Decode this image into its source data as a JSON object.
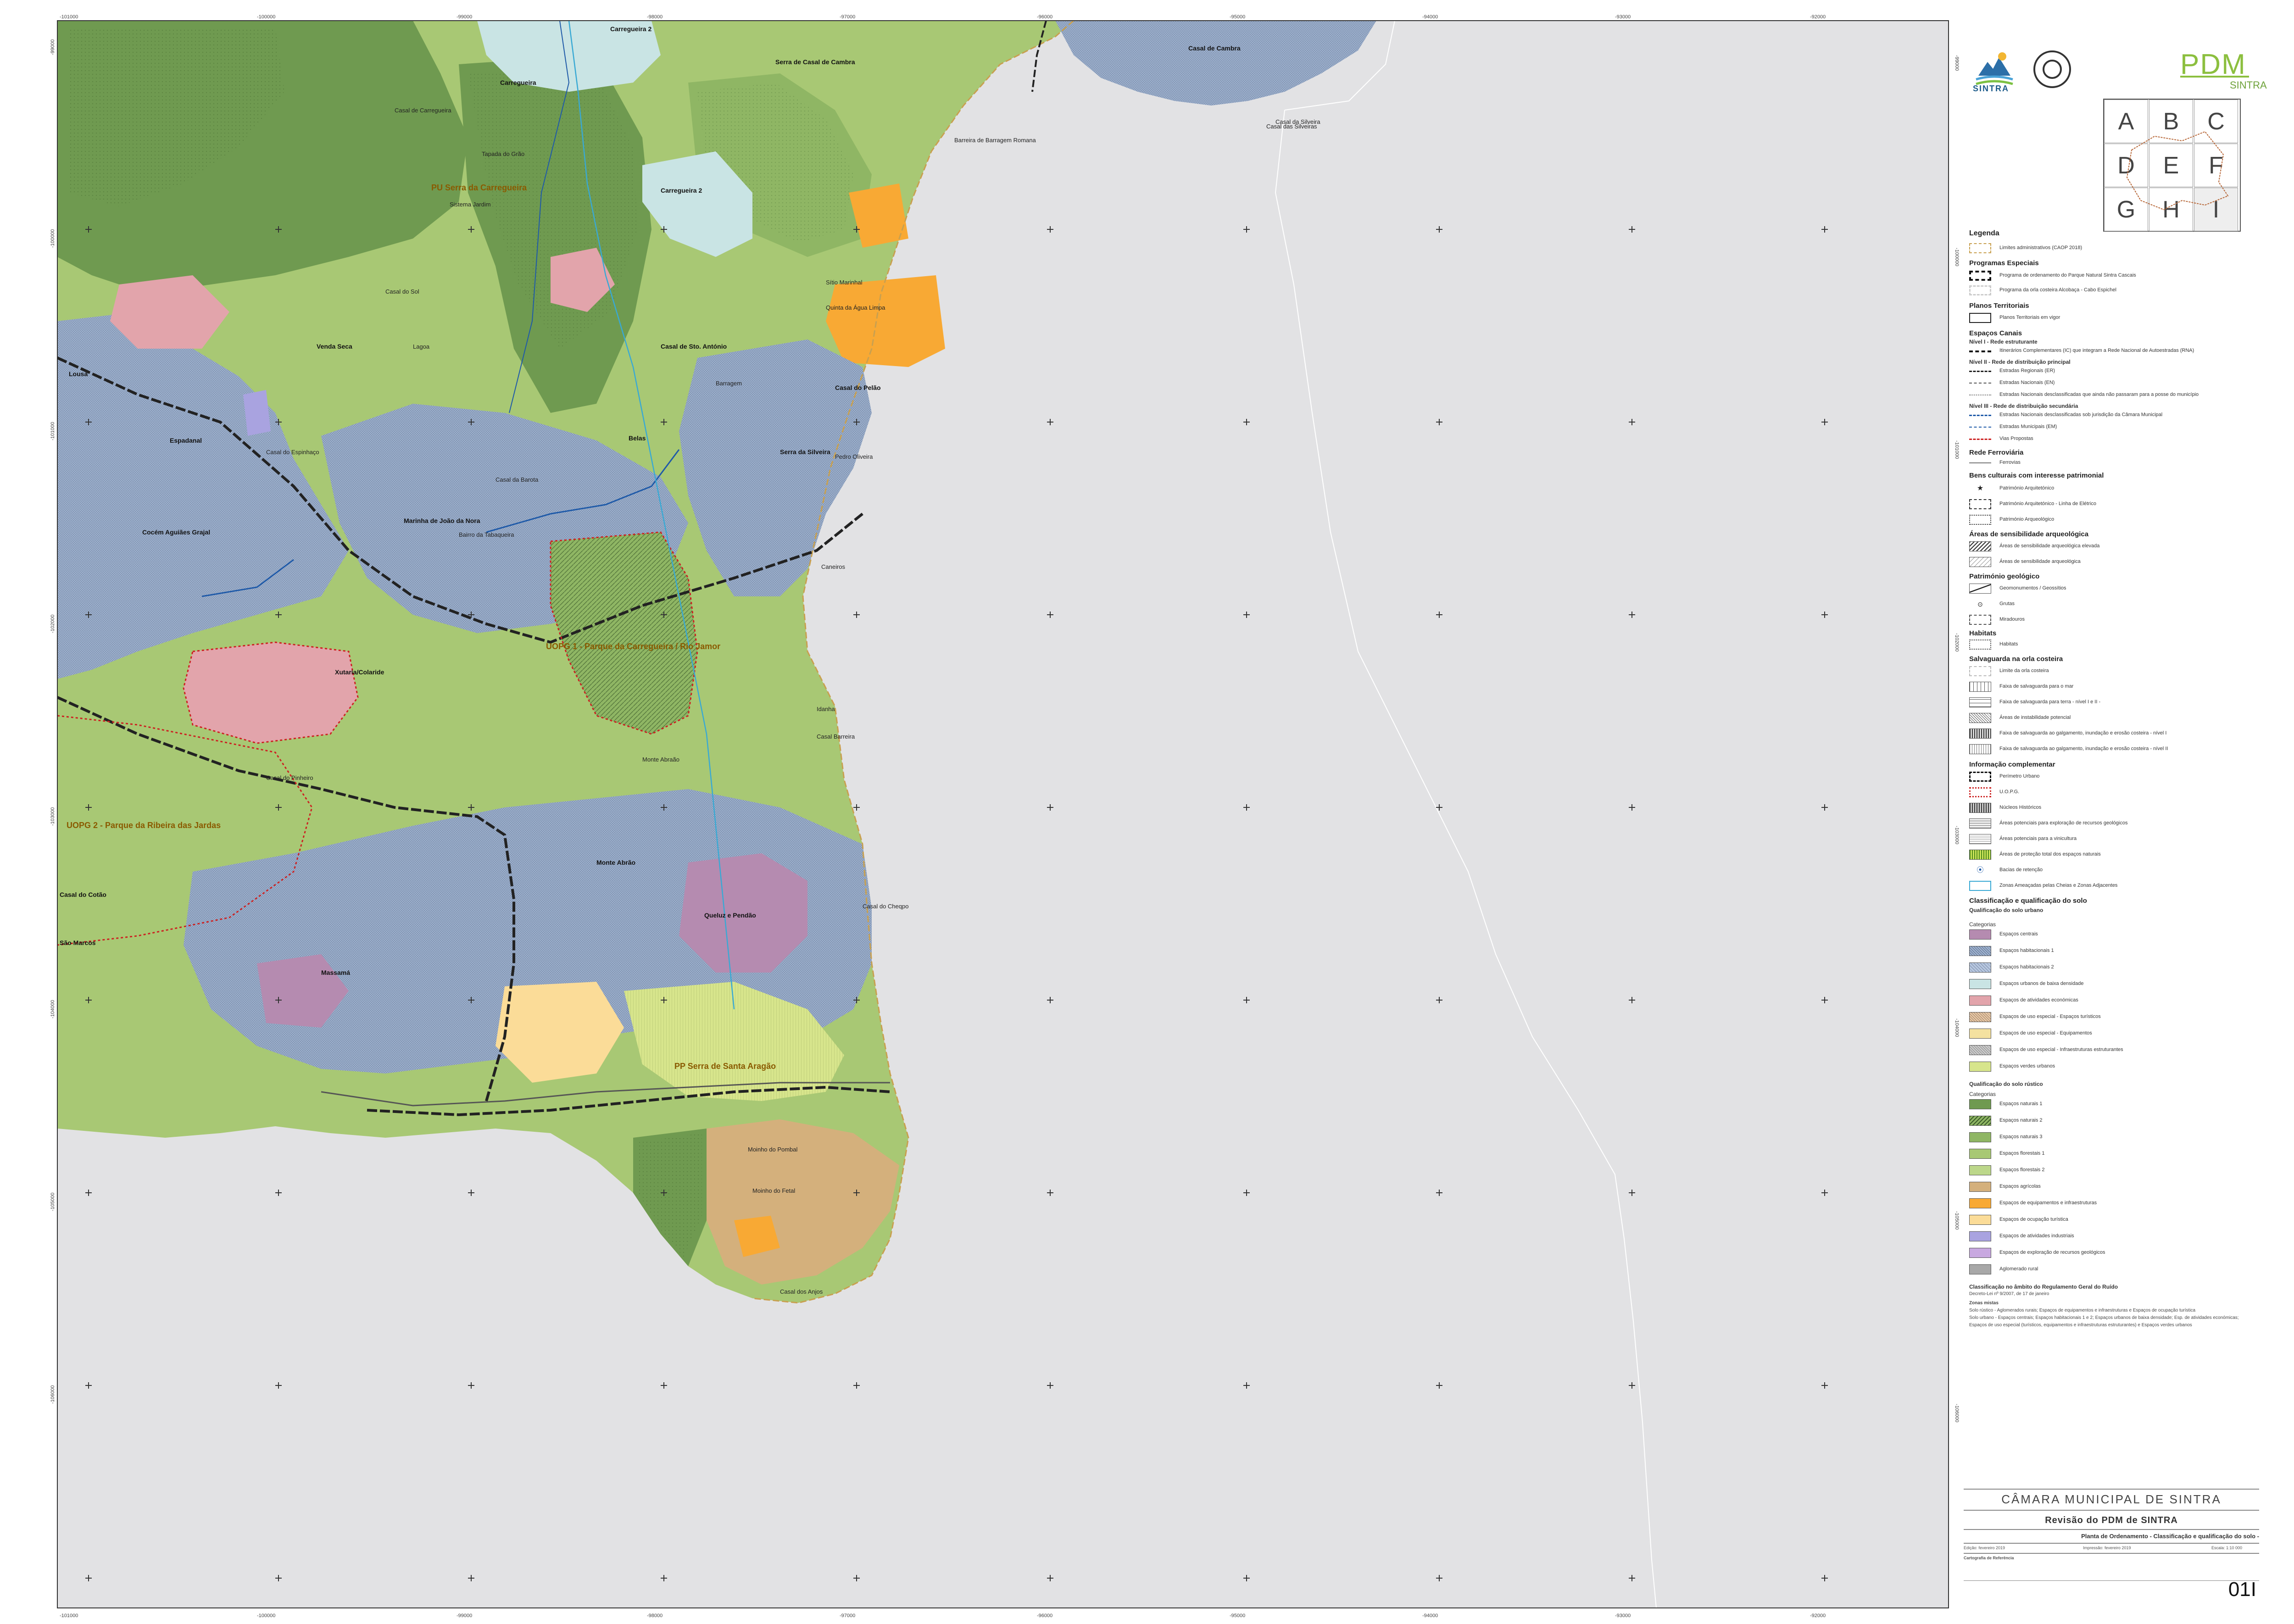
{
  "map": {
    "ticks_top": [
      "-101000",
      "-100000",
      "-99000",
      "-98000",
      "-97000",
      "-96000",
      "-95000",
      "-94000",
      "-93000",
      "-92000"
    ],
    "ticks_left": [
      "-99000",
      "-100000",
      "-101000",
      "-102000",
      "-103000",
      "-104000",
      "-105000",
      "-106000"
    ],
    "places_bold": [
      "Carregueira 2",
      "Serra de Casal de Cambra",
      "Casal de Cambra",
      "Carregueira",
      "Carregueira 2",
      "Venda Seca",
      "Casal de Sto. António",
      "Lousa",
      "Espadanal",
      "Serra da Silveira",
      "Belas",
      "Marinha de João da Nora",
      "Cocém Aguiães Grajal",
      "Xutaria/Colaride",
      "Monte Abrão",
      "Queluz e Pendão",
      "Massamá",
      "Casal do Cotão",
      "São Marcos",
      "Casal do Pelão"
    ],
    "places": [
      "Tapada do Grão",
      "Casal da Silveira",
      "Sistema Jardim",
      "Sítio Marinhal",
      "Quinta da Água Limpa",
      "Casal do Sol",
      "Lagoa",
      "Casal do Espinhaço",
      "Pedro Oliveira",
      "Caneiros",
      "Barragem",
      "Casal da Barota",
      "Idanha",
      "Bairro da Tabaqueira",
      "Casal de Carregueira",
      "Casal Barreira",
      "Monte Abraão",
      "Casal do Cheqpo",
      "Moinho do Pombal",
      "Moinho do Fetal",
      "Casal dos Anjos",
      "Casal das Silveiras",
      "Barreira de Barragem Romana",
      "Casal do Pinheiro"
    ],
    "places_big": [
      "PU Serra da Carregueira",
      "UOPG 1 - Parque da Carregueira / Rio Jamor",
      "UOPG 2 - Parque da Ribeira das Jardas",
      "PP Serra de Santa Aragão"
    ]
  },
  "legend": {
    "title": "Legenda",
    "limites": "Limites administrativos (CAOP 2018)",
    "programas_head": "Programas Especiais",
    "programas": [
      "Programa de ordenamento do Parque Natural Sintra Cascais",
      "Programa da orla costeira Alcobaça - Cabo Espichel"
    ],
    "planos_head": "Planos Territoriais",
    "planos": [
      "Planos Territoriais em vigor"
    ],
    "canais_head": "Espaços Canais",
    "nivel1": "Nível I - Rede estruturante",
    "nivel1_items": [
      "Itinerários Complementares (IC) que integram a Rede Nacional de Autoestradas (RNA)"
    ],
    "nivel2": "Nível II - Rede de distribuição principal",
    "nivel2_items": [
      "Estradas Regionais (ER)",
      "Estradas Nacionais (EN)",
      "Estradas Nacionais desclassificadas que ainda não passaram para a posse do município"
    ],
    "nivel3": "Nível III - Rede de distribuição secundária",
    "nivel3_items": [
      "Estradas Nacionais desclassificadas sob jurisdição da Câmara Municipal",
      "Estradas Municipais (EM)",
      "Vias Propostas"
    ],
    "ferro_head": "Rede Ferroviária",
    "ferro_items": [
      "Ferrovias"
    ],
    "bens_head": "Bens culturais com interesse patrimonial",
    "bens_items": [
      "Património Arquitetónico",
      "Património Arquitetónico - Linha de Elétrico",
      "Património Arqueológico"
    ],
    "areas_head": "Áreas de sensibilidade arqueológica",
    "areas_items": [
      "Áreas de sensibilidade arqueológica elevada",
      "Áreas de sensibilidade arqueológica"
    ],
    "geo_head": "Património geológico",
    "geo_items": [
      "Geomonumentos / Geossítios",
      "Grutas",
      "Miradouros"
    ],
    "hab_head": "Habitats",
    "hab_items": [
      "Habitats"
    ],
    "salv_head": "Salvaguarda na orla costeira",
    "salv_items": [
      "Limite da orla costeira",
      "Faixa de salvaguarda para o mar",
      "Faixa de salvaguarda para terra - nível I e II -",
      "Áreas de instabilidade potencial",
      "Faixa de salvaguarda ao galgamento, inundação e erosão costeira - nível I",
      "Faixa de salvaguarda ao galgamento, inundação e erosão costeira - nível II"
    ],
    "info_head": "Informação complementar",
    "info_items": [
      "Perímetro Urbano",
      "U.O.P.G.",
      "Núcleos Históricos",
      "Áreas potenciais para exploração de recursos geológicos",
      "Áreas potenciais para a vinicultura",
      "Áreas de proteção total dos espaços naturais",
      "Bacias de retenção",
      "Zonas Ameaçadas pelas Cheias e Zonas Adjacentes"
    ],
    "class_head": "Classificação e qualificação do solo",
    "urb_head": "Qualificação do solo urbano",
    "cat_label": "Categorias",
    "urb_items": [
      "Espaços centrais",
      "Espaços habitacionais 1",
      "Espaços habitacionais 2",
      "Espaços urbanos de baixa densidade",
      "Espaços de atividades económicas",
      "Espaços de uso especial - Espaços turísticos",
      "Espaços de uso especial - Equipamentos",
      "Espaços de uso especial - Infraestruturas estruturantes",
      "Espaços verdes urbanos"
    ],
    "rus_head": "Qualificação do solo rústico",
    "rus_items": [
      "Espaços naturais 1",
      "Espaços naturais 2",
      "Espaços naturais 3",
      "Espaços florestais 1",
      "Espaços florestais 2",
      "Espaços agrícolas",
      "Espaços de equipamentos e infraestruturas",
      "Espaços de ocupação turística",
      "Espaços de atividades industriais",
      "Espaços de exploração de recursos geológicos",
      "Aglomerado rural"
    ],
    "ruido_head": "Classificação no âmbito do Regulamento Geral do Ruído",
    "ruido_sub": "Decreto-Lei nº 9/2007, de 17 de janeiro",
    "zonas_label": "Zonas mistas",
    "ruido_notes": [
      "Solo rústico - Aglomerados rurais; Espaços de equipamentos e infraestruturas e Espaços de ocupação turística",
      "Solo urbano - Espaços centrais; Espaços habitacionais 1 e 2; Espaços urbanos de baixa densidade; Esp. de atividades económicas;",
      "Espaços de uso especial (turísticos, equipamentos e infraestruturas estruturantes) e Espaços verdes urbanos"
    ]
  },
  "colors": {
    "sea": "#e2e2e4",
    "natural1": "#6f9a50",
    "natural2": "#8fb664",
    "natural3": "#a8c874",
    "florestal": "#bcd78a",
    "agricola": "#d4b07c",
    "equip": "#f8a934",
    "turistica": "#fbdc98",
    "hab1": "#9fb3d0",
    "hab2": "#b8c8e0",
    "baixa": "#c9e4e4",
    "central": "#b58bb0",
    "ativ": "#e2a4ab",
    "industrial": "#a9a3e0",
    "geol": "#c8a8e0",
    "rural": "#a8a8a8",
    "verde": "#d7e58c",
    "uoe": "#f4e1a0"
  },
  "title_block": {
    "org": "CÂMARA MUNICIPAL DE SINTRA",
    "rev": "Revisão do PDM de SINTRA",
    "plan": "Planta de Ordenamento - Classificação e qualificação do solo -",
    "edicao": "Edição: fevereiro 2019",
    "impressao": "Impressão: fevereiro 2019",
    "escala": "Escala: 1:10 000",
    "cart": "Cartografia de Referência",
    "sheet": "01I"
  },
  "logos": {
    "sintra": "SINTRA",
    "pdm": "PDM",
    "pdm_sub": "SINTRA"
  },
  "keymap": [
    "A",
    "B",
    "C",
    "D",
    "E",
    "F",
    "G",
    "H",
    "I"
  ]
}
